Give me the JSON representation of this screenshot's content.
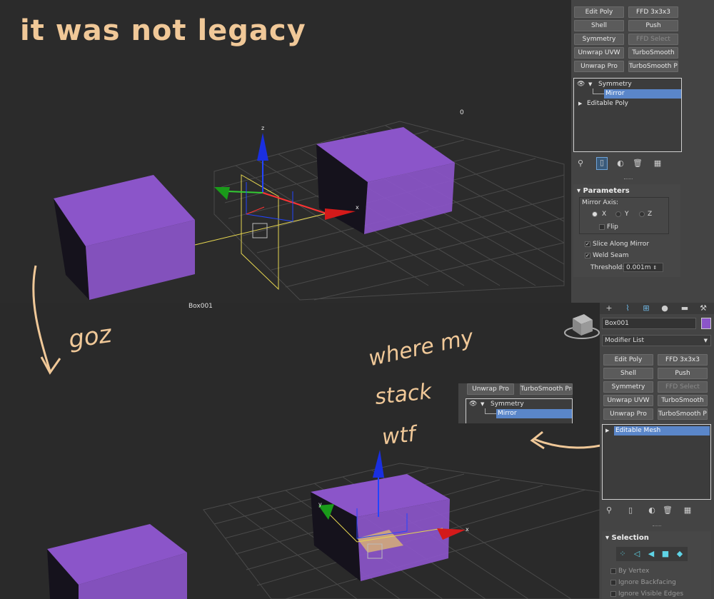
{
  "annotations": {
    "title": "it was not legacy",
    "goz": "goz",
    "where_line1": "where my",
    "where_line2": "stack",
    "where_line3": "wtf"
  },
  "viewport_top": {
    "label_zero": "0",
    "axis_x": "x",
    "axis_z": "z"
  },
  "viewport_bottom": {
    "object_label": "Box001",
    "axis_x": "x",
    "axis_y": "y"
  },
  "colors": {
    "box": "#8b55c9",
    "box_dark": "#15121c",
    "accent": "#5a86c9",
    "annotation": "#f0c898"
  },
  "panel_top": {
    "buttons": [
      "Edit Poly",
      "FFD 3x3x3",
      "Shell",
      "Push",
      "Symmetry",
      "FFD Select",
      "Unwrap UVW",
      "TurboSmooth",
      "Unwrap Pro",
      "TurboSmooth Pro"
    ],
    "stack": {
      "symmetry": "Symmetry",
      "mirror": "Mirror",
      "editable_poly": "Editable Poly"
    },
    "parameters": {
      "title": "Parameters",
      "mirror_axis": "Mirror Axis:",
      "x": "X",
      "y": "Y",
      "z": "Z",
      "flip": "Flip",
      "slice": "Slice Along Mirror",
      "weld": "Weld Seam",
      "threshold_label": "Threshold:",
      "threshold_value": "0.001m"
    }
  },
  "panel_bottom": {
    "name": "Box001",
    "modifier_list": "Modifier List",
    "buttons": [
      "Edit Poly",
      "FFD 3x3x3",
      "Shell",
      "Push",
      "Symmetry",
      "FFD Select",
      "Unwrap UVW",
      "TurboSmooth",
      "Unwrap Pro",
      "TurboSmooth Pro"
    ],
    "stack": {
      "editable_mesh": "Editable Mesh"
    },
    "selection": {
      "title": "Selection",
      "by_vertex": "By Vertex",
      "ignore_backfacing": "Ignore Backfacing",
      "ignore_visible_edges": "Ignore Visible Edges"
    }
  },
  "overlay_crop": {
    "unwrap_pro": "Unwrap Pro",
    "turbosmooth_pro": "TurboSmooth Pro",
    "symmetry": "Symmetry",
    "mirror": "Mirror"
  }
}
